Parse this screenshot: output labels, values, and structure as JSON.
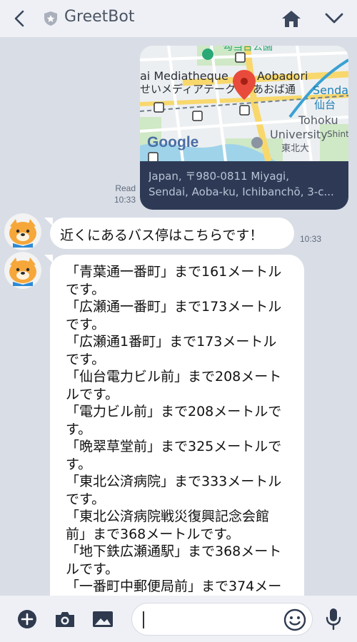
{
  "header": {
    "title": "GreetBot",
    "icons": [
      "back-icon",
      "shield-badge-icon",
      "home-icon",
      "chevron-down-icon"
    ]
  },
  "map_message": {
    "map_labels": {
      "park": "勾当台公園",
      "mediatheque_en": "ai Mediatheque",
      "mediatheque_ja": "せいメディアテーク",
      "aobadori_en": "Aobadori",
      "aobadori_ja": "あおば通",
      "sendai_en": "Senda",
      "sendai_ja": "仙台",
      "tohoku_en": "Tohoku",
      "university_en": "University",
      "tohoku_ja": "東北大",
      "shint": "Shint",
      "google": "Google"
    },
    "address_line1": "Japan, 〒980-0811 Miyagi,",
    "address_line2": "Sendai, Aoba-ku, Ichibanchō, 3-c...",
    "read_label": "Read",
    "time": "10:33"
  },
  "bot_messages": [
    {
      "text": "近くにあるバス停はこちらです！",
      "time": "10:33"
    },
    {
      "lines": [
        "「青葉通一番町」まで161メートル",
        "です。",
        "「広瀬通一番町」まで173メートル",
        "です。",
        "「広瀬通1番町」まで173メートル",
        "です。",
        "「仙台電力ビル前」まで208メート",
        "ルです。",
        "「電力ビル前」まで208メートルで",
        "す。",
        "「晩翠草堂前」まで325メートルで",
        "す。",
        "「東北公済病院」まで333メートル",
        "です。",
        "「東北公済病院戦災復興記念会館",
        "前」まで368メートルです。",
        "「地下鉄広瀬通駅」まで368メート",
        "ルです。",
        "「一番町中郵便局前」まで374メー"
      ]
    }
  ],
  "input_bar": {
    "placeholder": "",
    "icons": [
      "plus-icon",
      "camera-icon",
      "image-icon",
      "emoji-icon",
      "mic-icon"
    ]
  },
  "colors": {
    "header_bg": "#eef0f5",
    "chat_bg": "#d9dde6",
    "map_footer_bg": "#2e3a55",
    "bubble_bg": "#ffffff",
    "icon_dark": "#2f3a4f"
  }
}
